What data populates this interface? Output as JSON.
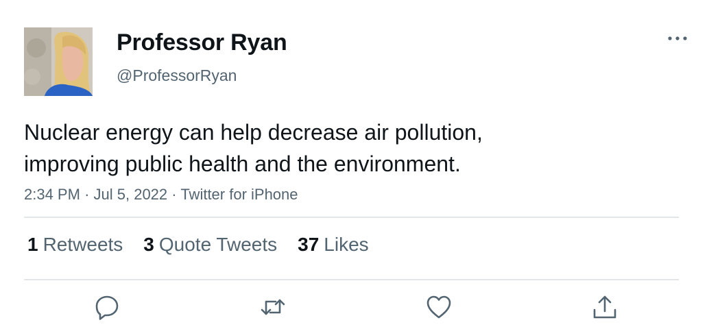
{
  "user": {
    "display_name": "Professor Ryan",
    "handle": "@ProfessorRyan"
  },
  "tweet": {
    "text_lines": [
      "Nuclear energy can help decrease air pollution,",
      "improving public health and the environment."
    ],
    "time": "2:34 PM",
    "date": "Jul 5, 2022",
    "source": "Twitter for iPhone",
    "separator": "·"
  },
  "stats": {
    "retweets": {
      "count": "1",
      "label": "Retweets"
    },
    "quotes": {
      "count": "3",
      "label": "Quote Tweets"
    },
    "likes": {
      "count": "37",
      "label": "Likes"
    }
  },
  "icons": {
    "more": "more-horizontal-icon",
    "reply": "reply-icon",
    "retweet": "retweet-icon",
    "like": "heart-icon",
    "share": "share-icon"
  },
  "colors": {
    "text_primary": "#0f1419",
    "text_secondary": "#536471",
    "divider": "#e3e6e8"
  }
}
